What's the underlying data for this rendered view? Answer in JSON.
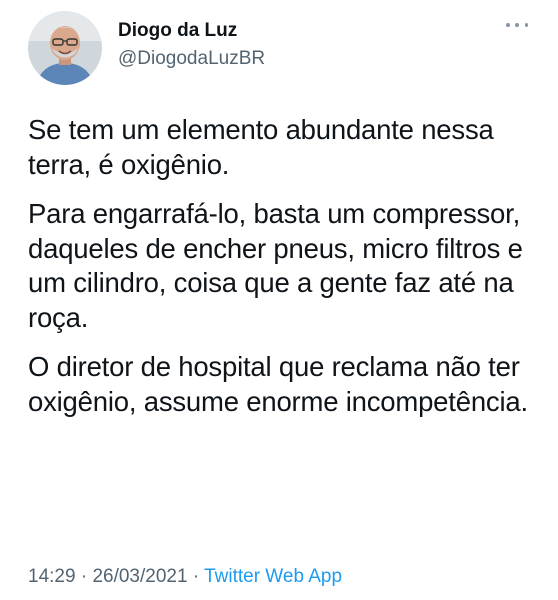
{
  "author": {
    "display_name": "Diogo da Luz",
    "handle": "@DiogodaLuzBR",
    "avatar_icon": "profile-photo"
  },
  "more_icon": "more-options-icon",
  "tweet": {
    "paragraphs": [
      "Se tem um elemento abundante nessa terra, é oxigênio.",
      "Para engarrafá-lo, basta um compressor, daqueles de encher pneus, micro filtros e um cilindro, coisa que a gente faz até na roça.",
      "O diretor de hospital que reclama não ter oxigênio, assume enorme incompetência."
    ]
  },
  "meta": {
    "time": "14:29",
    "separator_1": " · ",
    "date": "26/03/2021",
    "separator_2": " · ",
    "source": "Twitter Web App"
  },
  "colors": {
    "text": "#0f1419",
    "secondary": "#536471",
    "link": "#1d9bf0"
  }
}
